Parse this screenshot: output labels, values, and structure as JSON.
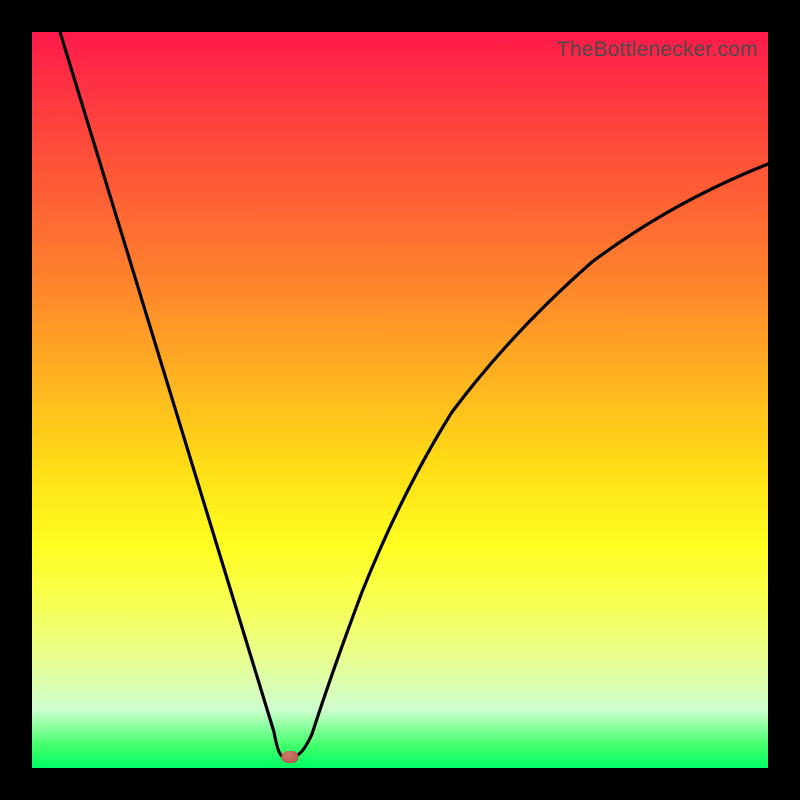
{
  "watermark": "TheBottlenecker.com",
  "chart_data": {
    "type": "line",
    "title": "",
    "xlabel": "",
    "ylabel": "",
    "xlim": [
      0,
      100
    ],
    "ylim": [
      0,
      100
    ],
    "x": [
      0,
      2,
      4,
      6,
      8,
      10,
      12,
      14,
      16,
      18,
      20,
      22,
      24,
      26,
      28,
      30,
      31,
      32,
      33,
      34,
      35,
      36,
      38,
      40,
      42,
      44,
      46,
      48,
      50,
      54,
      58,
      62,
      66,
      70,
      75,
      80,
      85,
      90,
      95,
      100
    ],
    "values": [
      100,
      94,
      88,
      82,
      76,
      70,
      64,
      58,
      52,
      46,
      40,
      34,
      28,
      22,
      16,
      10,
      7,
      4,
      2,
      1,
      1,
      2,
      6,
      12,
      18,
      24,
      29,
      34,
      38,
      45,
      51,
      56,
      60,
      64,
      68,
      72,
      75,
      78,
      80,
      82
    ],
    "marker": {
      "x": 34,
      "y": 1
    },
    "gradient_stops": [
      {
        "pos": 0,
        "color": "#ff1a4a"
      },
      {
        "pos": 50,
        "color": "#ffc020"
      },
      {
        "pos": 75,
        "color": "#ffff22"
      },
      {
        "pos": 100,
        "color": "#00ff66"
      }
    ]
  }
}
